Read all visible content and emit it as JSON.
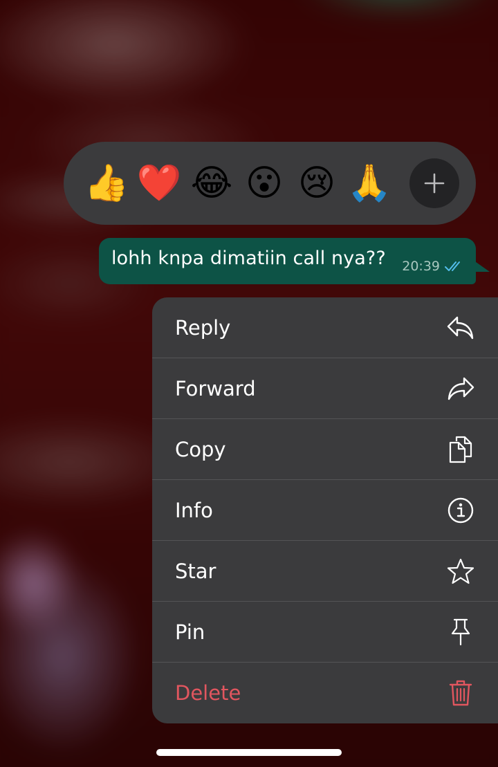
{
  "reactions": [
    {
      "emoji": "👍",
      "name": "thumbs-up"
    },
    {
      "emoji": "❤️",
      "name": "red-heart"
    },
    {
      "emoji": "😂",
      "name": "face-with-tears-of-joy"
    },
    {
      "emoji": "😮",
      "name": "face-with-open-mouth"
    },
    {
      "emoji": "😢",
      "name": "crying-face"
    },
    {
      "emoji": "🙏",
      "name": "folded-hands"
    }
  ],
  "message": {
    "text": "lohh knpa dimatiin call nya??",
    "time": "20:39",
    "status_icon": "double-check-read-icon"
  },
  "menu": {
    "items": [
      {
        "label": "Reply",
        "icon": "reply-icon"
      },
      {
        "label": "Forward",
        "icon": "forward-icon"
      },
      {
        "label": "Copy",
        "icon": "copy-icon"
      },
      {
        "label": "Info",
        "icon": "info-icon"
      },
      {
        "label": "Star",
        "icon": "star-icon"
      },
      {
        "label": "Pin",
        "icon": "pin-icon"
      },
      {
        "label": "Delete",
        "icon": "trash-icon"
      }
    ]
  },
  "colors": {
    "bubble": "#0d5346",
    "menu_bg": "#3b3b3d",
    "danger": "#e1565f",
    "read_ticks": "#53bdeb"
  }
}
